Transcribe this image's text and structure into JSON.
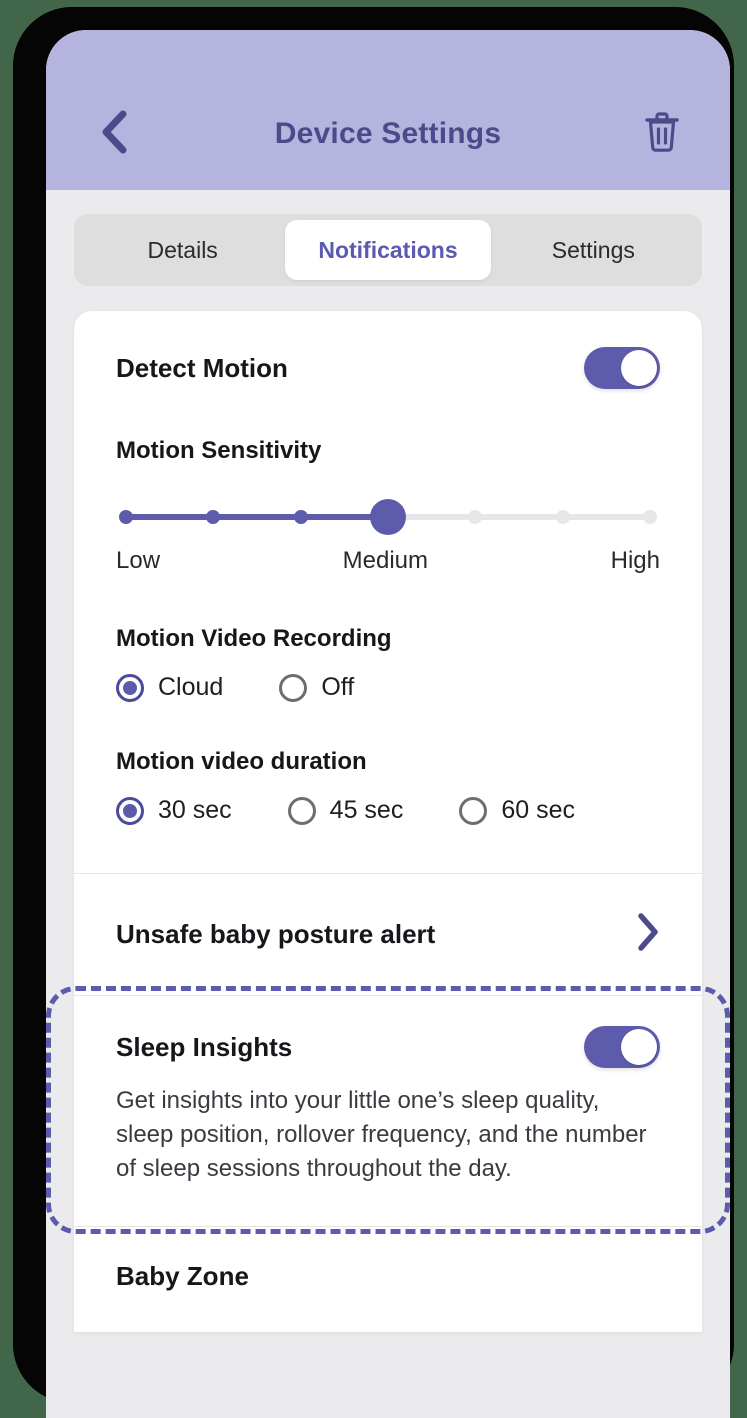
{
  "colors": {
    "header_bg": "#b5b4de",
    "accent": "#5d5cac",
    "title": "#4b4b8c",
    "page_bg": "#ebeaec",
    "tabbar_bg": "#dededf",
    "card_bg": "#ffffff",
    "bezel": "#050505",
    "outer": "#41664a"
  },
  "header": {
    "title": "Device Settings",
    "back_icon": "chevron-left-icon",
    "delete_icon": "trash-icon"
  },
  "tabs": [
    {
      "label": "Details",
      "active": false
    },
    {
      "label": "Notifications",
      "active": true
    },
    {
      "label": "Settings",
      "active": false
    }
  ],
  "detect_motion": {
    "label": "Detect Motion",
    "toggle_on": true
  },
  "motion_sensitivity": {
    "label": "Motion Sensitivity",
    "ticks": 7,
    "value_index": 3,
    "labels": {
      "low": "Low",
      "medium": "Medium",
      "high": "High"
    }
  },
  "motion_video_recording": {
    "label": "Motion Video Recording",
    "options": [
      {
        "label": "Cloud",
        "selected": true
      },
      {
        "label": "Off",
        "selected": false
      }
    ]
  },
  "motion_video_duration": {
    "label": "Motion video duration",
    "options": [
      {
        "label": "30 sec",
        "selected": true
      },
      {
        "label": "45 sec",
        "selected": false
      },
      {
        "label": "60 sec",
        "selected": false
      }
    ]
  },
  "posture_alert": {
    "label": "Unsafe baby posture alert",
    "chevron_icon": "chevron-right-icon"
  },
  "sleep_insights": {
    "label": "Sleep Insights",
    "toggle_on": true,
    "description": "Get insights into your little one’s sleep quality, sleep position, rollover frequency, and the number of sleep sessions throughout the day.",
    "highlighted": true
  },
  "baby_zone": {
    "label": "Baby Zone"
  }
}
